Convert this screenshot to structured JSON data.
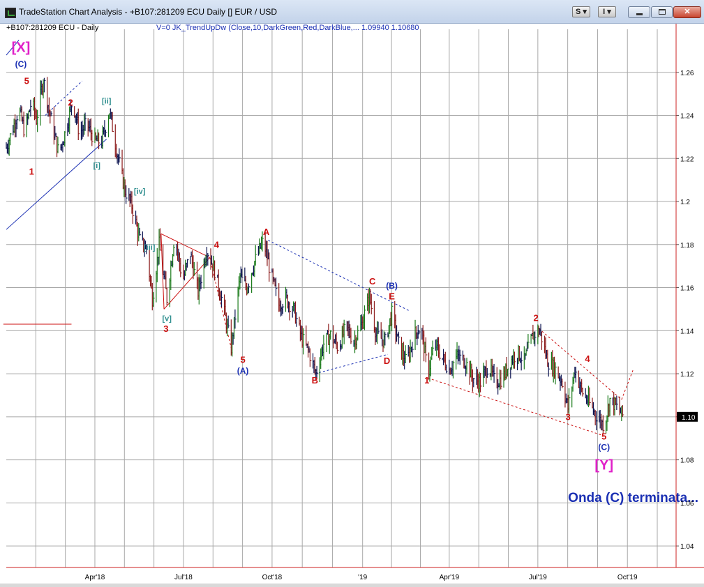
{
  "window": {
    "title": "TradeStation Chart Analysis - +B107:281209 ECU Daily [] EUR / USD",
    "buttons": {
      "s": "S ▾",
      "i": "I ▾",
      "close": "✕"
    }
  },
  "chart_header": {
    "symbol": "+B107:281209 ECU - Daily",
    "indicator": "V=0  JK_TrendUpDw  (Close,10,DarkGreen,Red,DarkBlue,...  1.09940  1.10680"
  },
  "colors": {
    "up": "#1a7a1a",
    "down": "#8b1a1a",
    "neutral": "#0b1350",
    "wave_red": "#cc1111",
    "wave_blue": "#1a2fb3",
    "wave_teal": "#2f8f8f",
    "wave_magenta": "#e020c8",
    "grid": "#a8a8a8",
    "axis": "#cc2222"
  },
  "chart_data": {
    "type": "line",
    "title": "",
    "xlabel": "",
    "ylabel": "",
    "ylim": [
      1.03,
      1.28
    ],
    "xlim": [
      "2018-01-01",
      "2019-11-20"
    ],
    "y_ticks": [
      "1.04",
      "1.06",
      "1.08",
      "1.1",
      "1.12",
      "1.14",
      "1.16",
      "1.18",
      "1.2",
      "1.22",
      "1.24",
      "1.26"
    ],
    "x_ticks": [
      {
        "date": "2018-04-02",
        "label": "Apr'18"
      },
      {
        "date": "2018-07-02",
        "label": "Jul'18"
      },
      {
        "date": "2018-10-01",
        "label": "Oct'18"
      },
      {
        "date": "2019-01-02",
        "label": "'19"
      },
      {
        "date": "2019-04-01",
        "label": "Apr'19"
      },
      {
        "date": "2019-07-01",
        "label": "Jul'19"
      },
      {
        "date": "2019-10-01",
        "label": "Oct'19"
      }
    ],
    "last_price_label": "1.10",
    "last_price": 1.1,
    "grid": true,
    "series": [
      {
        "values": [
          {
            "x": "2018-01-01",
            "y": 1.225
          },
          {
            "x": "2018-01-07",
            "y": 1.233
          },
          {
            "x": "2018-01-14",
            "y": 1.243
          },
          {
            "x": "2018-01-20",
            "y": 1.232
          },
          {
            "x": "2018-01-27",
            "y": 1.247
          },
          {
            "x": "2018-02-01",
            "y": 1.238
          },
          {
            "x": "2018-02-08",
            "y": 1.257
          },
          {
            "x": "2018-02-15",
            "y": 1.24
          },
          {
            "x": "2018-02-24",
            "y": 1.222
          },
          {
            "x": "2018-03-03",
            "y": 1.233
          },
          {
            "x": "2018-03-10",
            "y": 1.247
          },
          {
            "x": "2018-03-17",
            "y": 1.232
          },
          {
            "x": "2018-03-25",
            "y": 1.236
          },
          {
            "x": "2018-04-02",
            "y": 1.228
          },
          {
            "x": "2018-04-09",
            "y": 1.228
          },
          {
            "x": "2018-04-17",
            "y": 1.242
          },
          {
            "x": "2018-04-25",
            "y": 1.222
          },
          {
            "x": "2018-05-03",
            "y": 1.205
          },
          {
            "x": "2018-05-10",
            "y": 1.198
          },
          {
            "x": "2018-05-18",
            "y": 1.182
          },
          {
            "x": "2018-05-25",
            "y": 1.178
          },
          {
            "x": "2018-05-31",
            "y": 1.155
          },
          {
            "x": "2018-06-07",
            "y": 1.18
          },
          {
            "x": "2018-06-15",
            "y": 1.155
          },
          {
            "x": "2018-06-23",
            "y": 1.185
          },
          {
            "x": "2018-07-01",
            "y": 1.163
          },
          {
            "x": "2018-07-09",
            "y": 1.176
          },
          {
            "x": "2018-07-17",
            "y": 1.158
          },
          {
            "x": "2018-07-26",
            "y": 1.178
          },
          {
            "x": "2018-08-03",
            "y": 1.168
          },
          {
            "x": "2018-08-10",
            "y": 1.155
          },
          {
            "x": "2018-08-20",
            "y": 1.132
          },
          {
            "x": "2018-08-29",
            "y": 1.165
          },
          {
            "x": "2018-09-05",
            "y": 1.16
          },
          {
            "x": "2018-09-13",
            "y": 1.172
          },
          {
            "x": "2018-09-22",
            "y": 1.182
          },
          {
            "x": "2018-09-30",
            "y": 1.166
          },
          {
            "x": "2018-10-08",
            "y": 1.152
          },
          {
            "x": "2018-10-15",
            "y": 1.155
          },
          {
            "x": "2018-10-23",
            "y": 1.15
          },
          {
            "x": "2018-10-31",
            "y": 1.137
          },
          {
            "x": "2018-11-08",
            "y": 1.13
          },
          {
            "x": "2018-11-15",
            "y": 1.12
          },
          {
            "x": "2018-11-23",
            "y": 1.134
          },
          {
            "x": "2018-11-30",
            "y": 1.138
          },
          {
            "x": "2018-12-08",
            "y": 1.132
          },
          {
            "x": "2018-12-16",
            "y": 1.142
          },
          {
            "x": "2018-12-24",
            "y": 1.135
          },
          {
            "x": "2019-01-01",
            "y": 1.143
          },
          {
            "x": "2019-01-09",
            "y": 1.156
          },
          {
            "x": "2019-01-16",
            "y": 1.138
          },
          {
            "x": "2019-01-25",
            "y": 1.135
          },
          {
            "x": "2019-02-01",
            "y": 1.148
          },
          {
            "x": "2019-02-09",
            "y": 1.132
          },
          {
            "x": "2019-02-16",
            "y": 1.125
          },
          {
            "x": "2019-02-24",
            "y": 1.138
          },
          {
            "x": "2019-03-03",
            "y": 1.142
          },
          {
            "x": "2019-03-10",
            "y": 1.12
          },
          {
            "x": "2019-03-17",
            "y": 1.134
          },
          {
            "x": "2019-03-24",
            "y": 1.128
          },
          {
            "x": "2019-04-01",
            "y": 1.122
          },
          {
            "x": "2019-04-09",
            "y": 1.128
          },
          {
            "x": "2019-04-17",
            "y": 1.126
          },
          {
            "x": "2019-04-25",
            "y": 1.118
          },
          {
            "x": "2019-05-03",
            "y": 1.116
          },
          {
            "x": "2019-05-11",
            "y": 1.124
          },
          {
            "x": "2019-05-18",
            "y": 1.116
          },
          {
            "x": "2019-05-26",
            "y": 1.118
          },
          {
            "x": "2019-06-03",
            "y": 1.126
          },
          {
            "x": "2019-06-10",
            "y": 1.13
          },
          {
            "x": "2019-06-17",
            "y": 1.126
          },
          {
            "x": "2019-06-26",
            "y": 1.138
          },
          {
            "x": "2019-07-03",
            "y": 1.14
          },
          {
            "x": "2019-07-11",
            "y": 1.126
          },
          {
            "x": "2019-07-19",
            "y": 1.122
          },
          {
            "x": "2019-07-26",
            "y": 1.116
          },
          {
            "x": "2019-08-01",
            "y": 1.104
          },
          {
            "x": "2019-08-08",
            "y": 1.122
          },
          {
            "x": "2019-08-15",
            "y": 1.112
          },
          {
            "x": "2019-08-23",
            "y": 1.106
          },
          {
            "x": "2019-08-31",
            "y": 1.1
          },
          {
            "x": "2019-09-07",
            "y": 1.096
          },
          {
            "x": "2019-09-13",
            "y": 1.108
          },
          {
            "x": "2019-09-21",
            "y": 1.104
          },
          {
            "x": "2019-09-27",
            "y": 1.1
          }
        ]
      }
    ],
    "trendlines": [
      {
        "style": "solid",
        "color": "navy",
        "from": {
          "x": "2018-01-01",
          "y": 1.187
        },
        "to": {
          "x": "2018-04-14",
          "y": 1.229
        }
      },
      {
        "style": "dashed",
        "color": "navy",
        "from": {
          "x": "2018-02-10",
          "y": 1.24
        },
        "to": {
          "x": "2018-03-20",
          "y": 1.256
        }
      },
      {
        "style": "solid",
        "color": "navy",
        "from": {
          "x": "2018-01-01",
          "y": 1.268
        },
        "to": {
          "x": "2018-01-14",
          "y": 1.275
        }
      },
      {
        "style": "solid",
        "color": "red",
        "from": {
          "x": "2018-06-09",
          "y": 1.185
        },
        "to": {
          "x": "2018-07-29",
          "y": 1.174
        }
      },
      {
        "style": "solid",
        "color": "red",
        "from": {
          "x": "2018-06-09",
          "y": 1.185
        },
        "to": {
          "x": "2018-06-12",
          "y": 1.15
        }
      },
      {
        "style": "solid",
        "color": "red",
        "from": {
          "x": "2018-06-12",
          "y": 1.15
        },
        "to": {
          "x": "2018-07-29",
          "y": 1.174
        }
      },
      {
        "style": "dashed",
        "color": "red",
        "from": {
          "x": "2018-07-29",
          "y": 1.174
        },
        "to": {
          "x": "2018-08-20",
          "y": 1.132
        }
      },
      {
        "style": "dashed",
        "color": "navy",
        "from": {
          "x": "2018-09-27",
          "y": 1.182
        },
        "to": {
          "x": "2019-02-20",
          "y": 1.149
        }
      },
      {
        "style": "dashed",
        "color": "navy",
        "from": {
          "x": "2018-11-14",
          "y": 1.12
        },
        "to": {
          "x": "2019-01-28",
          "y": 1.129
        }
      },
      {
        "style": "dashed",
        "color": "red",
        "from": {
          "x": "2019-03-10",
          "y": 1.118
        },
        "to": {
          "x": "2019-09-08",
          "y": 1.091
        }
      },
      {
        "style": "dashed",
        "color": "red",
        "from": {
          "x": "2019-07-02",
          "y": 1.141
        },
        "to": {
          "x": "2019-09-25",
          "y": 1.108
        }
      },
      {
        "style": "dashed",
        "color": "red",
        "from": {
          "x": "2019-09-25",
          "y": 1.108
        },
        "to": {
          "x": "2019-10-07",
          "y": 1.122
        }
      },
      {
        "style": "solid",
        "color": "red",
        "from": {
          "x": "2017-12-29",
          "y": 1.143
        },
        "to": {
          "x": "2018-03-09",
          "y": 1.143
        }
      }
    ],
    "annotations": [
      {
        "text": "[X]",
        "x": "2018-01-16",
        "y": 1.2695,
        "color": "wave_magenta",
        "size": 20
      },
      {
        "text": "(C)",
        "x": "2018-01-16",
        "y": 1.2625,
        "color": "wave_blue",
        "size": 12
      },
      {
        "text": "5",
        "x": "2018-01-22",
        "y": 1.2545,
        "color": "wave_red",
        "size": 13
      },
      {
        "text": "2",
        "x": "2018-03-08",
        "y": 1.2445,
        "color": "wave_red",
        "size": 13
      },
      {
        "text": "[ii]",
        "x": "2018-04-14",
        "y": 1.2455,
        "color": "wave_teal",
        "size": 11
      },
      {
        "text": "1",
        "x": "2018-01-27",
        "y": 1.2125,
        "color": "wave_red",
        "size": 13
      },
      {
        "text": "[i]",
        "x": "2018-04-04",
        "y": 1.2155,
        "color": "wave_teal",
        "size": 11
      },
      {
        "text": "[iv]",
        "x": "2018-05-18",
        "y": 1.2035,
        "color": "wave_teal",
        "size": 11
      },
      {
        "text": "[iii]",
        "x": "2018-05-28",
        "y": 1.1775,
        "color": "wave_teal",
        "size": 11
      },
      {
        "text": "[v]",
        "x": "2018-06-15",
        "y": 1.1445,
        "color": "wave_teal",
        "size": 11
      },
      {
        "text": "3",
        "x": "2018-06-14",
        "y": 1.1395,
        "color": "wave_red",
        "size": 13
      },
      {
        "text": "4",
        "x": "2018-08-05",
        "y": 1.1785,
        "color": "wave_red",
        "size": 13
      },
      {
        "text": "5",
        "x": "2018-09-01",
        "y": 1.125,
        "color": "wave_red",
        "size": 13
      },
      {
        "text": "(A)",
        "x": "2018-09-01",
        "y": 1.12,
        "color": "wave_blue",
        "size": 12
      },
      {
        "text": "A",
        "x": "2018-09-25",
        "y": 1.1845,
        "color": "wave_red",
        "size": 13
      },
      {
        "text": "B",
        "x": "2018-11-14",
        "y": 1.1155,
        "color": "wave_red",
        "size": 13
      },
      {
        "text": "C",
        "x": "2019-01-12",
        "y": 1.1615,
        "color": "wave_red",
        "size": 13
      },
      {
        "text": "(B)",
        "x": "2019-02-01",
        "y": 1.1595,
        "color": "wave_blue",
        "size": 12
      },
      {
        "text": "E",
        "x": "2019-02-01",
        "y": 1.1545,
        "color": "wave_red",
        "size": 13
      },
      {
        "text": "D",
        "x": "2019-01-27",
        "y": 1.1245,
        "color": "wave_red",
        "size": 13
      },
      {
        "text": "1",
        "x": "2019-03-09",
        "y": 1.1155,
        "color": "wave_red",
        "size": 13
      },
      {
        "text": "2",
        "x": "2019-06-29",
        "y": 1.1445,
        "color": "wave_red",
        "size": 13
      },
      {
        "text": "4",
        "x": "2019-08-21",
        "y": 1.1255,
        "color": "wave_red",
        "size": 13
      },
      {
        "text": "3",
        "x": "2019-08-01",
        "y": 1.0985,
        "color": "wave_red",
        "size": 13
      },
      {
        "text": "5",
        "x": "2019-09-07",
        "y": 1.0895,
        "color": "wave_red",
        "size": 13
      },
      {
        "text": "(C)",
        "x": "2019-09-07",
        "y": 1.0845,
        "color": "wave_blue",
        "size": 12
      },
      {
        "text": "[Y]",
        "x": "2019-09-07",
        "y": 1.0755,
        "color": "wave_magenta",
        "size": 20
      },
      {
        "text": "Onda (C) terminata...",
        "x": "2019-10-07",
        "y": 1.0605,
        "color": "wave_blue",
        "size": 19
      }
    ]
  }
}
